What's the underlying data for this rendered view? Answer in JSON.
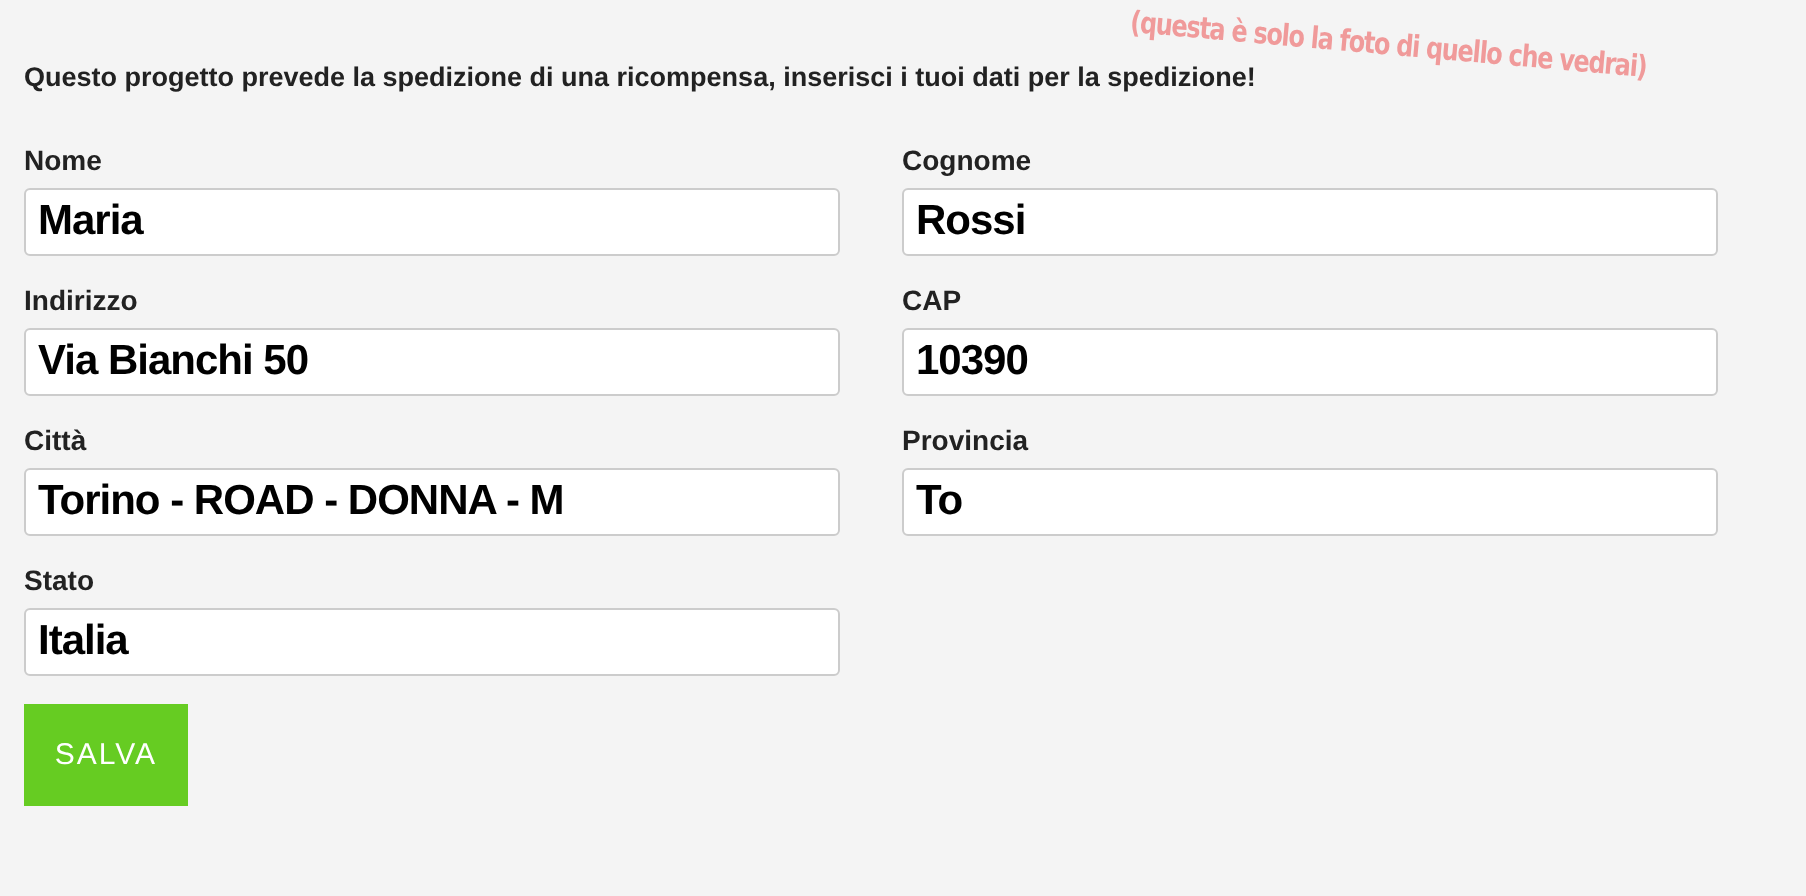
{
  "intro": "Questo progetto prevede la spedizione di una ricompensa, inserisci i tuoi dati per la spedizione!",
  "note": "(questa è solo la foto di quello che vedrai)",
  "fields": [
    {
      "label": "Nome",
      "value": "Maria"
    },
    {
      "label": "Cognome",
      "value": "Rossi"
    },
    {
      "label": "Indirizzo",
      "value": "Via Bianchi 50"
    },
    {
      "label": "CAP",
      "value": "10390"
    },
    {
      "label": "Città",
      "value": "Torino - ROAD - DONNA - M"
    },
    {
      "label": "Provincia",
      "value": "To"
    },
    {
      "label": "Stato",
      "value": "Italia"
    }
  ],
  "button": "SALVA"
}
